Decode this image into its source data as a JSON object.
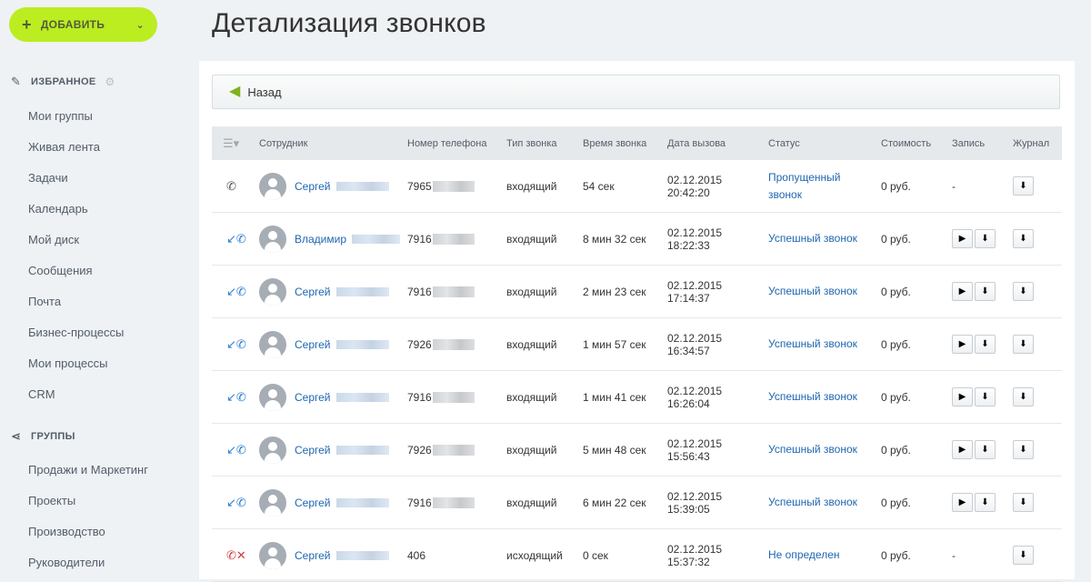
{
  "sidebar": {
    "add_button": "ДОБАВИТЬ",
    "favorites": {
      "title": "ИЗБРАННОЕ",
      "items": [
        "Мои группы",
        "Живая лента",
        "Задачи",
        "Календарь",
        "Мой диск",
        "Сообщения",
        "Почта",
        "Бизнес-процессы",
        "Мои процессы",
        "CRM"
      ]
    },
    "groups": {
      "title": "ГРУППЫ",
      "items": [
        "Продажи и Маркетинг",
        "Проекты",
        "Производство",
        "Руководители"
      ]
    }
  },
  "page": {
    "title": "Детализация звонков",
    "back_label": "Назад"
  },
  "table": {
    "headers": {
      "employee": "Сотрудник",
      "phone": "Номер телефона",
      "type": "Тип звонка",
      "duration": "Время звонка",
      "date": "Дата вызова",
      "status": "Статус",
      "cost": "Стоимость",
      "record": "Запись",
      "log": "Журнал"
    },
    "rows": [
      {
        "icon": "missed",
        "name": "Сергей",
        "phone": "7965",
        "type": "входящий",
        "duration": "54 сек",
        "date": "02.12.2015",
        "time": "20:42:20",
        "status": "Пропущенный звонок",
        "cost": "0 руб.",
        "record": "-"
      },
      {
        "icon": "incoming",
        "name": "Владимир",
        "phone": "7916",
        "type": "входящий",
        "duration": "8 мин 32 сек",
        "date": "02.12.2015",
        "time": "18:22:33",
        "status": "Успешный звонок",
        "cost": "0 руб.",
        "record": ""
      },
      {
        "icon": "incoming",
        "name": "Сергей",
        "phone": "7916",
        "type": "входящий",
        "duration": "2 мин 23 сек",
        "date": "02.12.2015",
        "time": "17:14:37",
        "status": "Успешный звонок",
        "cost": "0 руб.",
        "record": ""
      },
      {
        "icon": "incoming",
        "name": "Сергей",
        "phone": "7926",
        "type": "входящий",
        "duration": "1 мин 57 сек",
        "date": "02.12.2015",
        "time": "16:34:57",
        "status": "Успешный звонок",
        "cost": "0 руб.",
        "record": ""
      },
      {
        "icon": "incoming",
        "name": "Сергей",
        "phone": "7916",
        "type": "входящий",
        "duration": "1 мин 41 сек",
        "date": "02.12.2015",
        "time": "16:26:04",
        "status": "Успешный звонок",
        "cost": "0 руб.",
        "record": ""
      },
      {
        "icon": "incoming",
        "name": "Сергей",
        "phone": "7926",
        "type": "входящий",
        "duration": "5 мин 48 сек",
        "date": "02.12.2015",
        "time": "15:56:43",
        "status": "Успешный звонок",
        "cost": "0 руб.",
        "record": ""
      },
      {
        "icon": "incoming",
        "name": "Сергей",
        "phone": "7916",
        "type": "входящий",
        "duration": "6 мин 22 сек",
        "date": "02.12.2015",
        "time": "15:39:05",
        "status": "Успешный звонок",
        "cost": "0 руб.",
        "record": ""
      },
      {
        "icon": "outgoing-failed",
        "name": "Сергей",
        "phone": "406",
        "type": "исходящий",
        "duration": "0 сек",
        "date": "02.12.2015",
        "time": "15:37:32",
        "status": "Не определен",
        "cost": "0 руб.",
        "record": "-"
      }
    ]
  },
  "icons": {
    "add": "plus-icon",
    "favorites": "pin-icon",
    "settings": "gear-icon",
    "groups": "share-icon",
    "back": "back-arrow-icon",
    "columns_menu": "menu-icon",
    "play": "play-icon",
    "download": "download-icon"
  },
  "colors": {
    "accent_green": "#bbed21",
    "link_blue": "#2067b0",
    "missed_icon": "#555555",
    "incoming_icon": "#2f7fd1",
    "failed_icon": "#d33b3b"
  }
}
